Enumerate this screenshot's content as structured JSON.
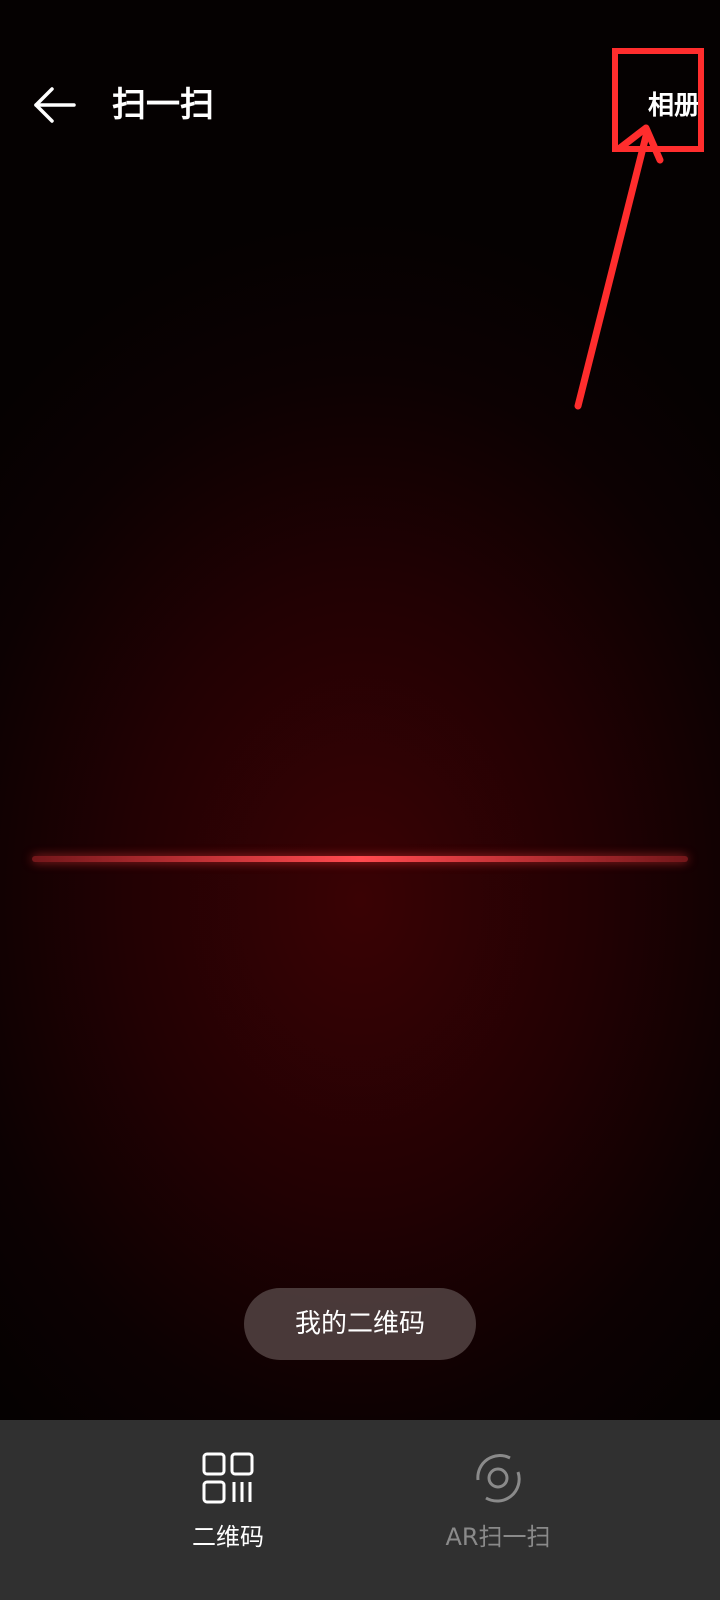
{
  "header": {
    "title": "扫一扫",
    "back_icon": "arrow-left-icon",
    "album_label": "相册"
  },
  "annotation": {
    "color": "#ff2d2d"
  },
  "scanner": {
    "line_color": "#ff4a4f"
  },
  "my_qr_button": {
    "label": "我的二维码"
  },
  "bottom_tabs": {
    "items": [
      {
        "label": "二维码",
        "icon": "qr-code-icon",
        "selected": true
      },
      {
        "label": "AR扫一扫",
        "icon": "ar-scan-icon",
        "selected": false
      }
    ]
  },
  "colors": {
    "background": "#220103",
    "bottom_bar": "#303030",
    "active_tab": "#ffffff",
    "inactive_tab": "#8a8a8a"
  }
}
